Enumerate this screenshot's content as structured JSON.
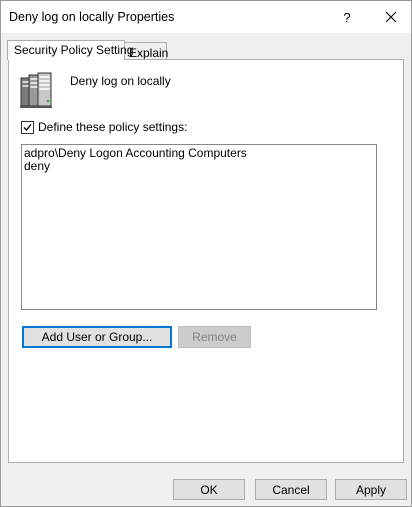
{
  "window": {
    "title": "Deny log on locally Properties",
    "help_label": "?",
    "close_icon": "close-icon"
  },
  "tabs": [
    {
      "label": "Security Policy Setting",
      "active": true
    },
    {
      "label": "Explain",
      "active": false
    }
  ],
  "policy": {
    "icon": "server-icon",
    "name": "Deny log on locally"
  },
  "define_settings": {
    "label": "Define these policy settings:",
    "checked": true
  },
  "members": [
    "adpro\\Deny Logon Accounting Computers",
    "deny"
  ],
  "buttons": {
    "add": "Add User or Group...",
    "remove": "Remove",
    "ok": "OK",
    "cancel": "Cancel",
    "apply": "Apply"
  },
  "colors": {
    "focus_border": "#0078d7",
    "disabled_text": "#838383"
  }
}
